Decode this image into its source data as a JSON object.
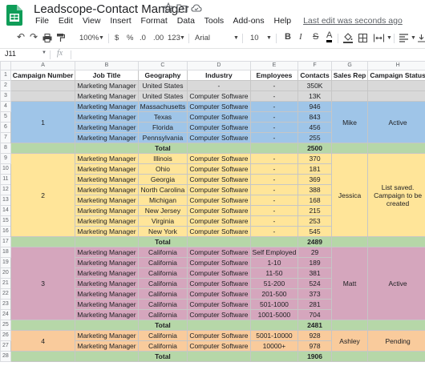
{
  "app": {
    "title": "Leadscope-Contact Manager",
    "menus": [
      "File",
      "Edit",
      "View",
      "Insert",
      "Format",
      "Data",
      "Tools",
      "Add-ons",
      "Help"
    ],
    "last_edit": "Last edit was seconds ago"
  },
  "toolbar": {
    "zoom": "100%",
    "currency": "$",
    "percent": "%",
    "dec_less": ".0",
    "dec_more": ".00",
    "more_formats": "123",
    "font": "Arial",
    "font_size": "10",
    "bold": "B",
    "italic": "I",
    "strike": "S",
    "text_color": "A"
  },
  "formula_bar": {
    "cell_ref": "J11",
    "fx": "fx",
    "value": ""
  },
  "columns": [
    "A",
    "B",
    "C",
    "D",
    "E",
    "F",
    "G",
    "H"
  ],
  "colors": {
    "blue": "#9fc5e8",
    "yellow": "#ffe599",
    "purple": "#d5a6bd",
    "orange": "#f9cb9c",
    "green": "#b6d7a8",
    "gray": "#d9d9d9",
    "brand_green": "#0f9d58"
  },
  "header": [
    "Campaign Number",
    "Job Title",
    "Geography",
    "Industry",
    "Employees",
    "Contacts",
    "Sales Rep",
    "Campaign Status"
  ],
  "rows": [
    {
      "n": "2",
      "cells": [
        "",
        "Marketing Manager",
        "United States",
        "-",
        "-",
        "350K"
      ],
      "color": "gray"
    },
    {
      "n": "3",
      "cells": [
        "",
        "Marketing Manager",
        "United States",
        "Computer Software",
        "-",
        "13K"
      ],
      "color": "gray"
    },
    {
      "n": "4",
      "cells": [
        "",
        "Marketing Manager",
        "Massachusetts",
        "Computer Software",
        "-",
        "946"
      ],
      "color": "blue"
    },
    {
      "n": "5",
      "cells": [
        "",
        "Marketing Manager",
        "Texas",
        "Computer Software",
        "-",
        "843"
      ],
      "color": "blue"
    },
    {
      "n": "6",
      "cells": [
        "",
        "Marketing Manager",
        "Florida",
        "Computer Software",
        "-",
        "456"
      ],
      "color": "blue"
    },
    {
      "n": "7",
      "cells": [
        "",
        "Marketing Manager",
        "Pennsylvania",
        "Computer Software",
        "-",
        "255"
      ],
      "color": "blue"
    },
    {
      "n": "8",
      "total": "Total",
      "value": "2500"
    },
    {
      "n": "9",
      "cells": [
        "",
        "Marketing Manager",
        "Illinois",
        "Computer Software",
        "-",
        "370"
      ],
      "color": "yellow"
    },
    {
      "n": "10",
      "cells": [
        "",
        "Marketing Manager",
        "Ohio",
        "Computer Software",
        "-",
        "181"
      ],
      "color": "yellow"
    },
    {
      "n": "11",
      "cells": [
        "",
        "Marketing Manager",
        "Georgia",
        "Computer Software",
        "-",
        "369"
      ],
      "color": "yellow"
    },
    {
      "n": "12",
      "cells": [
        "",
        "Marketing Manager",
        "North Carolina",
        "Computer Software",
        "-",
        "388"
      ],
      "color": "yellow"
    },
    {
      "n": "13",
      "cells": [
        "",
        "Marketing Manager",
        "Michigan",
        "Computer Software",
        "-",
        "168"
      ],
      "color": "yellow"
    },
    {
      "n": "14",
      "cells": [
        "",
        "Marketing Manager",
        "New Jersey",
        "Computer Software",
        "-",
        "215"
      ],
      "color": "yellow"
    },
    {
      "n": "15",
      "cells": [
        "",
        "Marketing Manager",
        "Virginia",
        "Computer Software",
        "-",
        "253"
      ],
      "color": "yellow"
    },
    {
      "n": "16",
      "cells": [
        "",
        "Marketing Manager",
        "New York",
        "Computer Software",
        "-",
        "545"
      ],
      "color": "yellow"
    },
    {
      "n": "17",
      "total": "Total",
      "value": "2489"
    },
    {
      "n": "18",
      "cells": [
        "",
        "Marketing Manager",
        "California",
        "Computer Software",
        "Self Employed",
        "29"
      ],
      "color": "purple"
    },
    {
      "n": "19",
      "cells": [
        "",
        "Marketing Manager",
        "California",
        "Computer Software",
        "1-10",
        "189"
      ],
      "color": "purple"
    },
    {
      "n": "20",
      "cells": [
        "",
        "Marketing Manager",
        "California",
        "Computer Software",
        "11-50",
        "381"
      ],
      "color": "purple"
    },
    {
      "n": "21",
      "cells": [
        "",
        "Marketing Manager",
        "California",
        "Computer Software",
        "51-200",
        "524"
      ],
      "color": "purple"
    },
    {
      "n": "22",
      "cells": [
        "",
        "Marketing Manager",
        "California",
        "Computer Software",
        "201-500",
        "373"
      ],
      "color": "purple"
    },
    {
      "n": "23",
      "cells": [
        "",
        "Marketing Manager",
        "California",
        "Computer Software",
        "501-1000",
        "281"
      ],
      "color": "purple"
    },
    {
      "n": "24",
      "cells": [
        "",
        "Marketing Manager",
        "California",
        "Computer Software",
        "1001-5000",
        "704"
      ],
      "color": "purple"
    },
    {
      "n": "25",
      "total": "Total",
      "value": "2481"
    },
    {
      "n": "26",
      "cells": [
        "",
        "Marketing Manager",
        "California",
        "Computer Software",
        "5001-10000",
        "928"
      ],
      "color": "orange"
    },
    {
      "n": "27",
      "cells": [
        "",
        "Marketing Manager",
        "California",
        "Computer Software",
        "10000+",
        "978"
      ],
      "color": "orange"
    },
    {
      "n": "28",
      "total": "Total",
      "value": "1906"
    }
  ],
  "groups": [
    {
      "start": "4",
      "span": 4,
      "campaign": "1",
      "rep": "Mike",
      "status": "Active",
      "color": "blue"
    },
    {
      "start": "9",
      "span": 8,
      "campaign": "2",
      "rep": "Jessica",
      "status": "List saved. Campaign to be created",
      "color": "yellow"
    },
    {
      "start": "18",
      "span": 7,
      "campaign": "3",
      "rep": "Matt",
      "status": "Active",
      "color": "purple"
    },
    {
      "start": "26",
      "span": 2,
      "campaign": "4",
      "rep": "Ashley",
      "status": "Pending",
      "color": "orange"
    }
  ]
}
